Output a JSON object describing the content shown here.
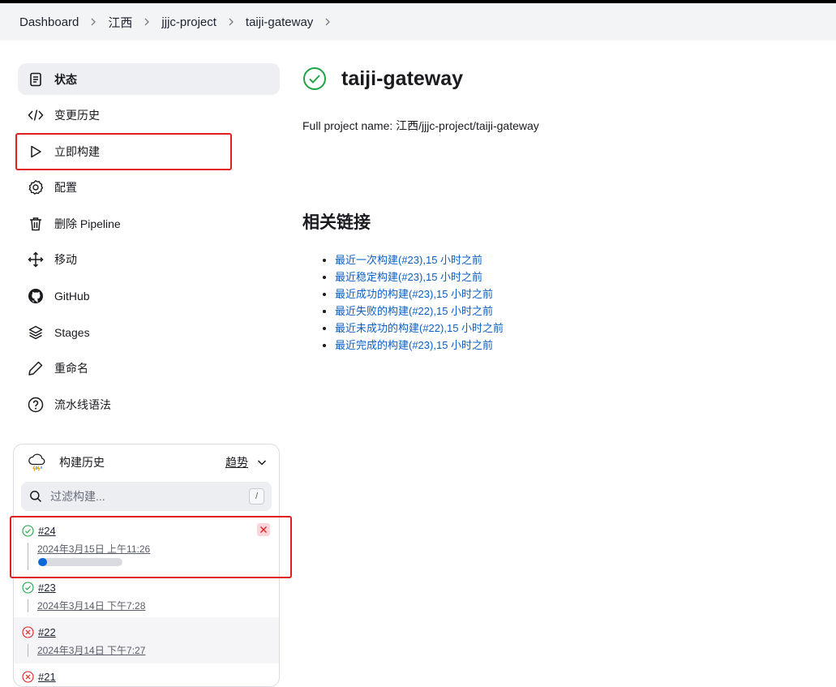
{
  "breadcrumb": [
    "Dashboard",
    "江西",
    "jjjc-project",
    "taiji-gateway"
  ],
  "sidebar": {
    "items": [
      {
        "label": "状态",
        "icon": "document-icon",
        "active": true
      },
      {
        "label": "变更历史",
        "icon": "code-icon"
      },
      {
        "label": "立即构建",
        "icon": "play-icon"
      },
      {
        "label": "配置",
        "icon": "gear-icon"
      },
      {
        "label": "删除 Pipeline",
        "icon": "trash-icon"
      },
      {
        "label": "移动",
        "icon": "move-icon"
      },
      {
        "label": "GitHub",
        "icon": "github-icon"
      },
      {
        "label": "Stages",
        "icon": "layers-icon"
      },
      {
        "label": "重命名",
        "icon": "pencil-icon"
      },
      {
        "label": "流水线语法",
        "icon": "help-icon"
      }
    ]
  },
  "build_history": {
    "title": "构建历史",
    "trend": "趋势",
    "filter_placeholder": "过滤构建...",
    "filter_shortcut": "/",
    "builds": [
      {
        "number": "#24",
        "date": "2024年3月15日 上午11:26",
        "status": "success",
        "progress": 0.11,
        "running": true
      },
      {
        "number": "#23",
        "date": "2024年3月14日 下午7:28",
        "status": "success"
      },
      {
        "number": "#22",
        "date": "2024年3月14日 下午7:27",
        "status": "failed"
      },
      {
        "number": "#21",
        "status": "failed"
      }
    ]
  },
  "main": {
    "title": "taiji-gateway",
    "full_name": "Full project name: 江西/jjjc-project/taiji-gateway",
    "related_heading": "相关链接",
    "links": [
      "最近一次构建(#23),15 小时之前",
      "最近稳定构建(#23),15 小时之前",
      "最近成功的构建(#23),15 小时之前",
      "最近失败的构建(#22),15 小时之前",
      "最近未成功的构建(#22),15 小时之前",
      "最近完成的构建(#23),15 小时之前"
    ]
  },
  "colors": {
    "success": "#1ea446",
    "failed": "#e0201e",
    "link": "#0b5fc4",
    "progress": "#0b68d6",
    "highlight": "#e0201e"
  }
}
